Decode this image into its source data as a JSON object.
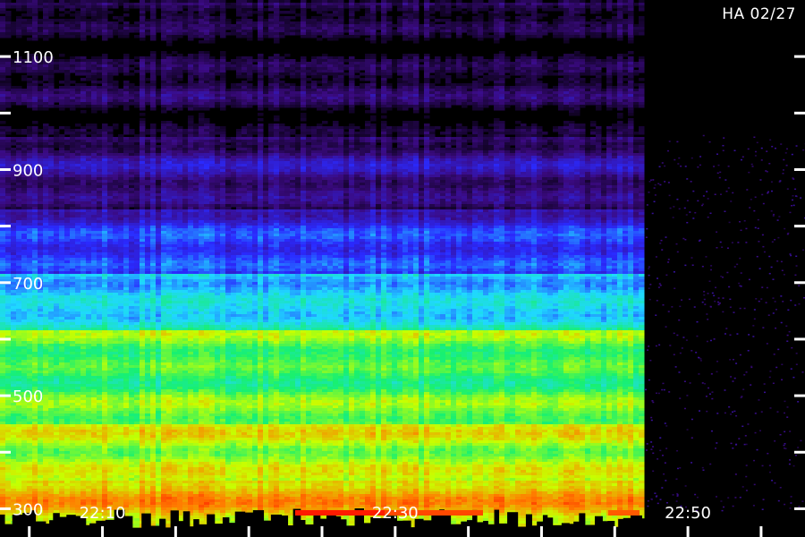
{
  "header": {
    "station_label": "HA 02/27"
  },
  "chart_data": {
    "type": "heatmap",
    "title": "",
    "xlabel": "",
    "ylabel": "",
    "x_range": [
      "22:03",
      "22:58"
    ],
    "y_range": [
      250,
      1200
    ],
    "y_ticks": [
      {
        "value": 300,
        "label": "300"
      },
      {
        "value": 400,
        "label": ""
      },
      {
        "value": 500,
        "label": "500"
      },
      {
        "value": 600,
        "label": ""
      },
      {
        "value": 700,
        "label": "700"
      },
      {
        "value": 800,
        "label": ""
      },
      {
        "value": 900,
        "label": "900"
      },
      {
        "value": 1000,
        "label": ""
      },
      {
        "value": 1100,
        "label": "1100"
      }
    ],
    "x_ticks": [
      {
        "value": "22:05",
        "label": ""
      },
      {
        "value": "22:10",
        "label": "22:10"
      },
      {
        "value": "22:15",
        "label": ""
      },
      {
        "value": "22:20",
        "label": ""
      },
      {
        "value": "22:25",
        "label": ""
      },
      {
        "value": "22:30",
        "label": "22:30"
      },
      {
        "value": "22:35",
        "label": ""
      },
      {
        "value": "22:40",
        "label": ""
      },
      {
        "value": "22:45",
        "label": ""
      },
      {
        "value": "22:50",
        "label": "22:50"
      },
      {
        "value": "22:55",
        "label": ""
      }
    ],
    "signal_end_time": "22:47",
    "intensity_bands": [
      {
        "y_from": 250,
        "y_to": 350,
        "level": 0.78
      },
      {
        "y_from": 350,
        "y_to": 450,
        "level": 0.72
      },
      {
        "y_from": 450,
        "y_to": 620,
        "level": 0.62
      },
      {
        "y_from": 620,
        "y_to": 720,
        "level": 0.45
      },
      {
        "y_from": 720,
        "y_to": 830,
        "level": 0.27
      },
      {
        "y_from": 830,
        "y_to": 960,
        "level": 0.14
      },
      {
        "y_from": 960,
        "y_to": 1200,
        "level": 0.06
      }
    ],
    "colormap": [
      "#000000",
      "#3a0a80",
      "#2a2aff",
      "#1fd8ff",
      "#18f070",
      "#c8ff00",
      "#ff8000",
      "#ff0000"
    ],
    "grid": false,
    "legend": "none"
  }
}
